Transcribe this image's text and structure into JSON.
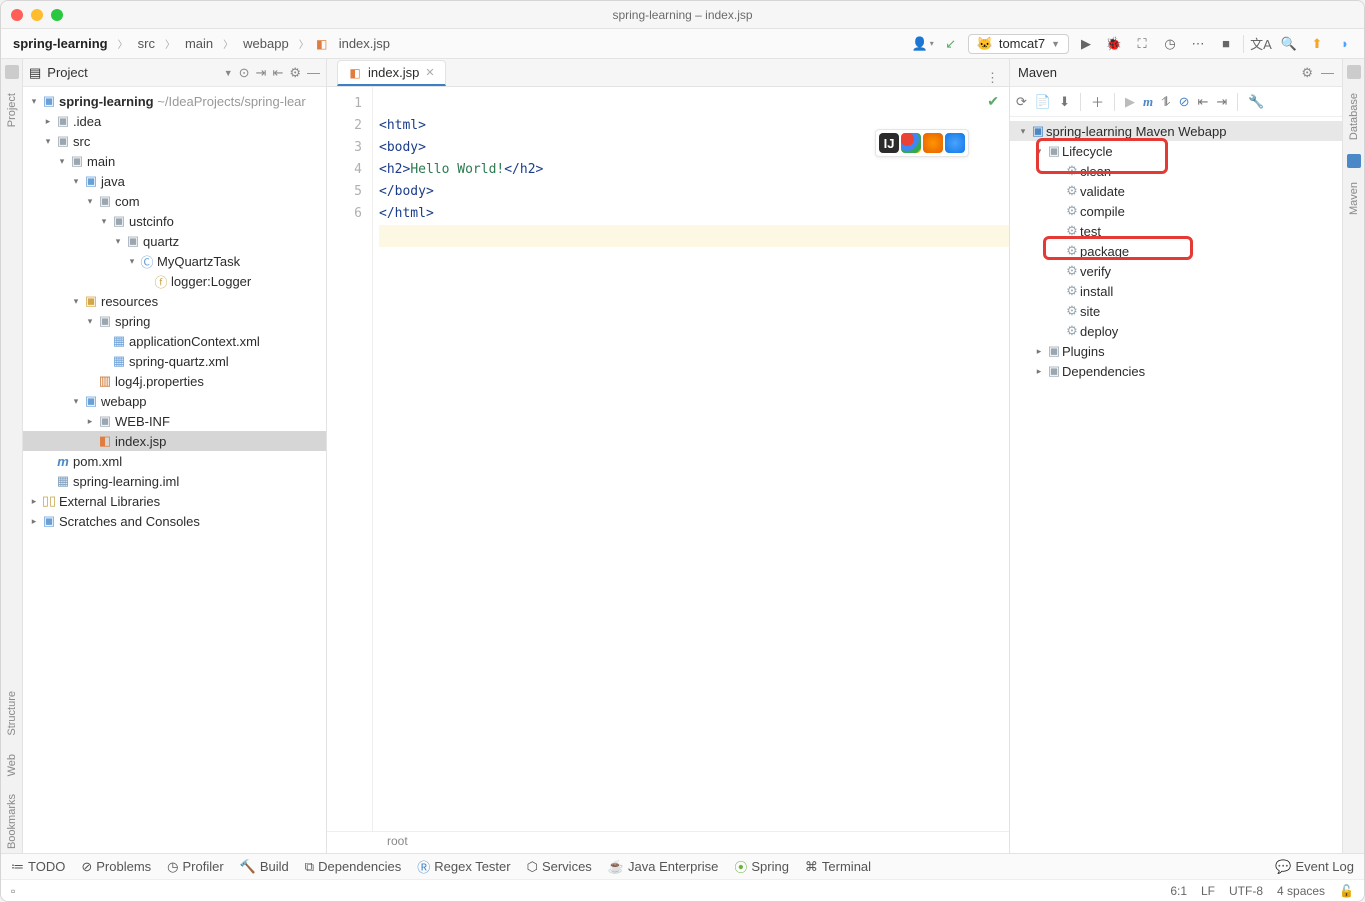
{
  "title": "spring-learning – index.jsp",
  "breadcrumbs": [
    "spring-learning",
    "src",
    "main",
    "webapp",
    "index.jsp"
  ],
  "run_config": "tomcat7",
  "project_panel_title": "Project",
  "tree": {
    "root": {
      "name": "spring-learning",
      "hint": "~/IdeaProjects/spring-lear"
    },
    "idea": ".idea",
    "src": "src",
    "main": "main",
    "java": "java",
    "com": "com",
    "ustcinfo": "ustcinfo",
    "quartz": "quartz",
    "myquartztask": "MyQuartzTask",
    "logger": "logger:Logger",
    "resources": "resources",
    "spring": "spring",
    "appcontext": "applicationContext.xml",
    "springquartz": "spring-quartz.xml",
    "log4j": "log4j.properties",
    "webapp": "webapp",
    "webinf": "WEB-INF",
    "indexjsp": "index.jsp",
    "pom": "pom.xml",
    "iml": "spring-learning.iml",
    "extlib": "External Libraries",
    "scratch": "Scratches and Consoles"
  },
  "editor": {
    "tab": "index.jsp",
    "lines": [
      "1",
      "2",
      "3",
      "4",
      "5",
      "6"
    ],
    "code": {
      "l1a": "<html>",
      "l2a": "<body>",
      "l3a": "<h2>",
      "l3b": "Hello World!",
      "l3c": "</h2>",
      "l4a": "</body>",
      "l5a": "</html>"
    },
    "crumb": "root"
  },
  "maven": {
    "title": "Maven",
    "root": "spring-learning Maven Webapp",
    "lifecycle": "Lifecycle",
    "goals": [
      "clean",
      "validate",
      "compile",
      "test",
      "package",
      "verify",
      "install",
      "site",
      "deploy"
    ],
    "plugins": "Plugins",
    "deps": "Dependencies"
  },
  "right_tabs": {
    "database": "Database",
    "maven": "Maven"
  },
  "left_tabs": {
    "project": "Project",
    "structure": "Structure",
    "web": "Web",
    "bookmarks": "Bookmarks"
  },
  "bottom": {
    "tools": [
      "TODO",
      "Problems",
      "Profiler",
      "Build",
      "Dependencies",
      "Regex Tester",
      "Services",
      "Java Enterprise",
      "Spring",
      "Terminal"
    ],
    "eventlog": "Event Log"
  },
  "status": {
    "pos": "6:1",
    "lf": "LF",
    "enc": "UTF-8",
    "indent": "4 spaces"
  }
}
